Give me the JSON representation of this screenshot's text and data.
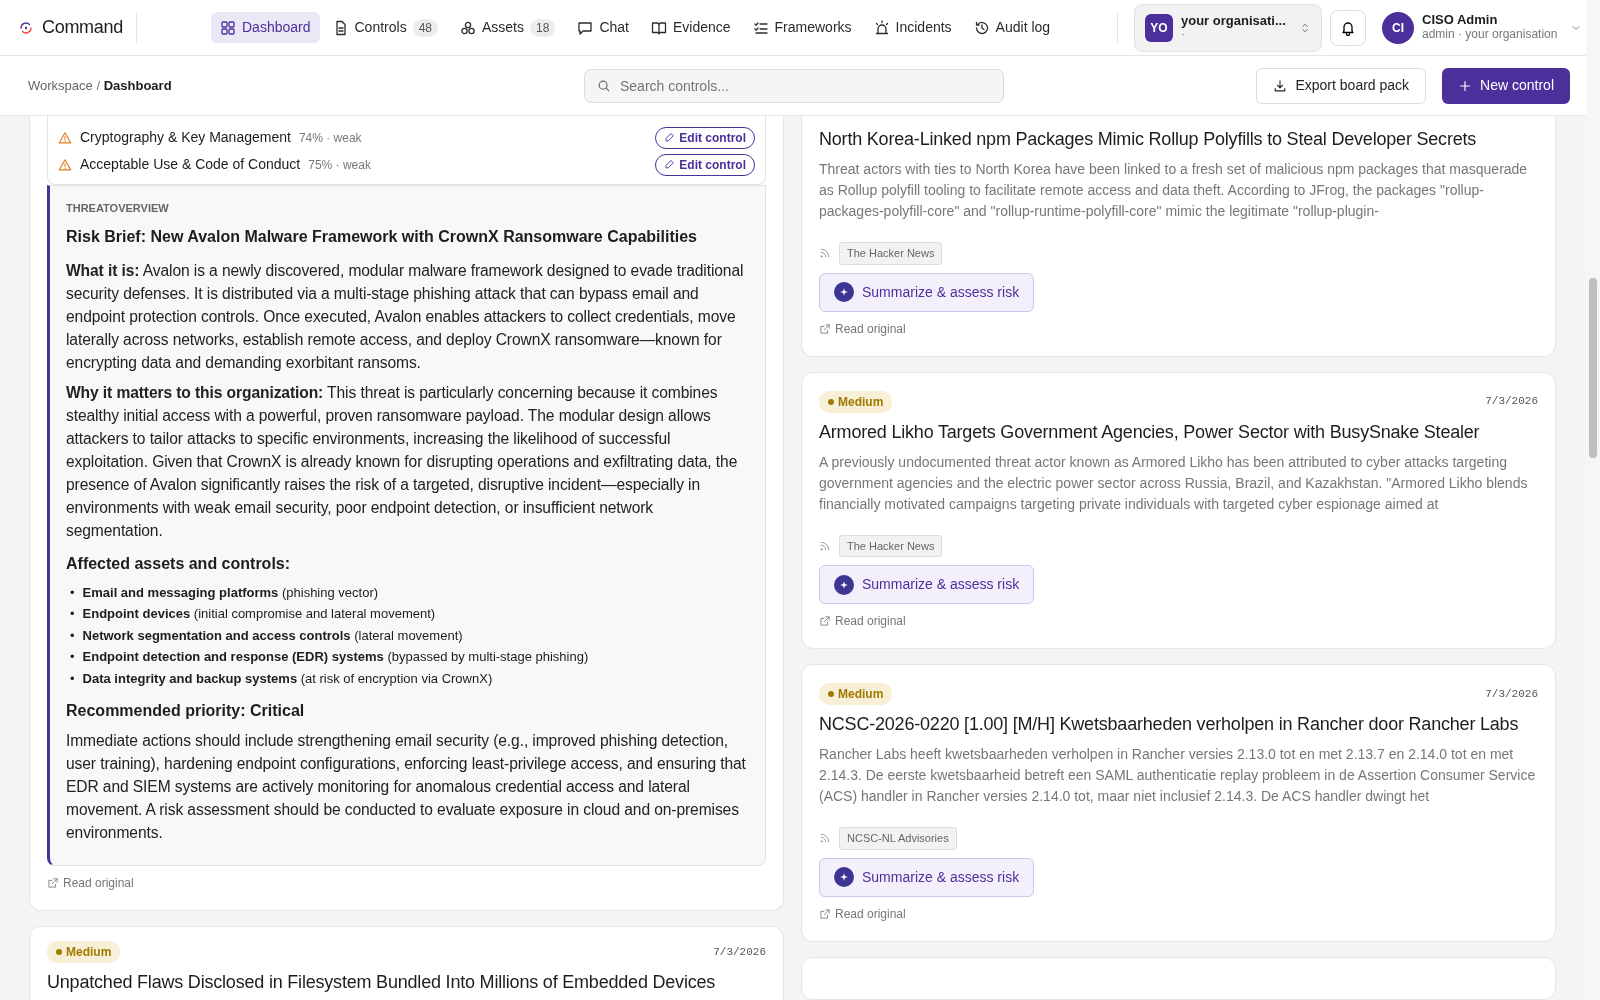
{
  "header": {
    "brand": "Command",
    "nav": [
      {
        "label": "Dashboard",
        "selected": true
      },
      {
        "label": "Controls",
        "count": "48",
        "selected": false
      },
      {
        "label": "Assets",
        "count": "18",
        "selected": false
      },
      {
        "label": "Chat",
        "selected": false
      },
      {
        "label": "Evidence",
        "selected": false
      },
      {
        "label": "Frameworks",
        "selected": false
      },
      {
        "label": "Incidents",
        "selected": false
      },
      {
        "label": "Audit log",
        "selected": false
      }
    ],
    "organisation": {
      "initials": "YO",
      "name": "your organisati...",
      "sub": "·"
    },
    "user": {
      "initials": "CI",
      "name": "CISO Admin",
      "sub": "admin · your organisation"
    }
  },
  "toolbar": {
    "breadcrumb": [
      "Workspace",
      "Dashboard"
    ],
    "breadcrumb_separator": "/",
    "search": {
      "placeholder": "Search controls..."
    },
    "buttons": [
      {
        "label": "Export board pack",
        "kind": "export"
      },
      {
        "label": "New control",
        "kind": "new"
      }
    ]
  },
  "left_feed": [
    {
      "kind": "brief",
      "weak_controls": [
        {
          "name": "Cryptography & Key Management",
          "reading": "74% · weak",
          "action": "Edit control"
        },
        {
          "name": "Acceptable Use & Code of Conduct",
          "reading": "75% · weak",
          "action": "Edit control"
        }
      ],
      "brief": {
        "label": "THREATOVERVIEW",
        "title": "Risk Brief: New Avalon Malware Framework with CrownX Ransomware Capabilities",
        "blocks": [
          {
            "kind": "para",
            "text": "**What it is:** Avalon is a newly discovered, modular malware framework designed to evade traditional security defenses. It is distributed via a multi-stage phishing attack that can bypass email and endpoint protection controls. Once executed, Avalon enables attackers to collect credentials, move laterally across networks, establish remote access, and deploy CrownX ransomware—known for encrypting data and demanding exorbitant ransoms."
          },
          {
            "kind": "para",
            "text": "**Why it matters to this organization:** This threat is particularly concerning because it combines stealthy initial access with a powerful, proven ransomware payload. The modular design allows attackers to tailor attacks to specific environments, increasing the likelihood of successful exploitation. Given that CrownX is already known for disrupting operations and exfiltrating data, the presence of Avalon significantly raises the risk of a targeted, disruptive incident—especially in environments with weak email security, poor endpoint detection, or insufficient network segmentation."
          },
          {
            "kind": "heading",
            "text": "Affected assets and controls:"
          },
          {
            "kind": "list",
            "bullet": "•",
            "items": [
              "**Email and messaging platforms** (phishing vector)",
              "**Endpoint devices** (initial compromise and lateral movement)",
              "**Network segmentation and access controls** (lateral movement)",
              "**Endpoint detection and response (EDR) systems** (bypassed by multi-stage phishing)",
              "**Data integrity and backup systems** (at risk of encryption via CrownX)"
            ]
          },
          {
            "kind": "heading",
            "text": "Recommended priority: Critical"
          },
          {
            "kind": "para",
            "text": "Immediate actions should include strengthening email security (e.g., improved phishing detection, user training), hardening endpoint configurations, enforcing least-privilege access, and ensuring that EDR and SIEM systems are actively monitoring for anomalous credential access and lateral movement. A risk assessment should be conducted to evaluate exposure in cloud and on-premises environments."
          }
        ]
      },
      "link": "Read original"
    },
    {
      "kind": "item",
      "severity": "Medium",
      "date": "7/3/2026",
      "title": "Unpatched Flaws Disclosed in Filesystem Bundled Into Millions of Embedded Devices"
    }
  ],
  "right_feed": [
    {
      "kind": "item",
      "title": "North Korea-Linked npm Packages Mimic Rollup Polyfills to Steal Developer Secrets",
      "summary": "Threat actors with ties to North Korea have been linked to a fresh set of malicious npm packages that masquerade as Rollup polyfill tooling to facilitate remote access and data theft. According to JFrog, the packages \"rollup-packages-polyfill-core\" and \"rollup-runtime-polyfill-core\" mimic the legitimate \"rollup-plugin-",
      "source": "The Hacker News",
      "action": "Summarize & assess risk",
      "link": "Read original"
    },
    {
      "kind": "item",
      "severity": "Medium",
      "date": "7/3/2026",
      "title": "Armored Likho Targets Government Agencies, Power Sector with BusySnake Stealer",
      "summary": "A previously undocumented threat actor known as Armored Likho has been attributed to cyber attacks targeting government agencies and the electric power sector across Russia, Brazil, and Kazakhstan. \"Armored Likho blends financially motivated campaigns targeting private individuals with targeted cyber espionage aimed at",
      "source": "The Hacker News",
      "action": "Summarize & assess risk",
      "link": "Read original"
    },
    {
      "kind": "item",
      "severity": "Medium",
      "date": "7/3/2026",
      "title": "NCSC-2026-0220 [1.00] [M/H] Kwetsbaarheden verholpen in Rancher door Rancher Labs",
      "summary": "Rancher Labs heeft kwetsbaarheden verholpen in Rancher versies 2.13.0 tot en met 2.13.7 en 2.14.0 tot en met 2.14.3. De eerste kwetsbaarheid betreft een SAML authenticatie replay probleem in de Assertion Consumer Service (ACS) handler in Rancher versies 2.14.0 tot, maar niet inclusief 2.14.3. De ACS handler dwingt het",
      "source": "NCSC-NL Advisories",
      "action": "Summarize & assess risk",
      "link": "Read original"
    },
    {
      "kind": "stub"
    }
  ]
}
